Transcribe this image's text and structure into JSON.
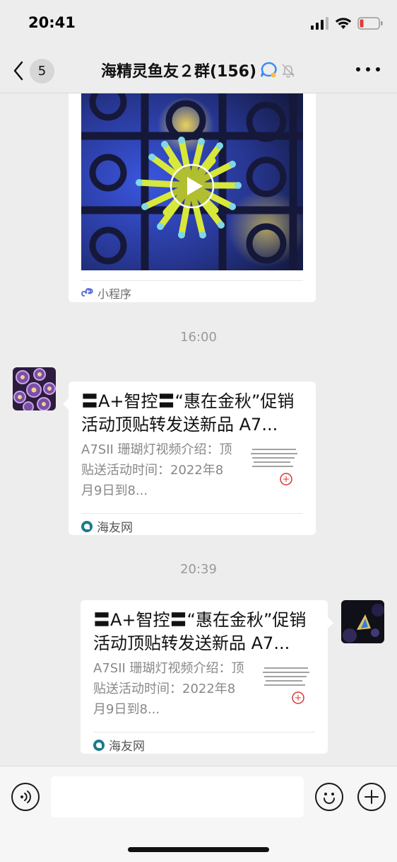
{
  "status_bar": {
    "time": "20:41"
  },
  "nav": {
    "back_count": "5",
    "title": "海精灵鱼友２群(156)"
  },
  "messages": [
    {
      "type": "mini-program-video",
      "source_label": "小程序"
    },
    {
      "type": "time",
      "text": "16:00"
    },
    {
      "type": "link-card",
      "side": "left",
      "title": "〓A+智控〓“惠在金秋”促销活动顶贴转发送新品 A7...",
      "desc": "A7SII 珊瑚灯视频介绍：顶贴送活动时间：2022年8月9日到8...",
      "source": "海友网"
    },
    {
      "type": "time",
      "text": "20:39"
    },
    {
      "type": "link-card",
      "side": "right",
      "title": "〓A+智控〓“惠在金秋”促销活动顶贴转发送新品 A7...",
      "desc": "A7SII 珊瑚灯视频介绍：顶贴送活动时间：2022年8月9日到8...",
      "source": "海友网"
    }
  ],
  "input_bar": {
    "value": ""
  },
  "colors": {
    "background": "#ededed",
    "card": "#ffffff",
    "input_bar": "#f6f6f6"
  },
  "icons": [
    "signal-icon",
    "wifi-icon",
    "battery-icon",
    "chevron-left-icon",
    "mute-bell-icon",
    "more-icon",
    "play-icon",
    "mini-program-icon",
    "source-logo-icon",
    "voice-icon",
    "emoji-icon",
    "plus-icon"
  ]
}
